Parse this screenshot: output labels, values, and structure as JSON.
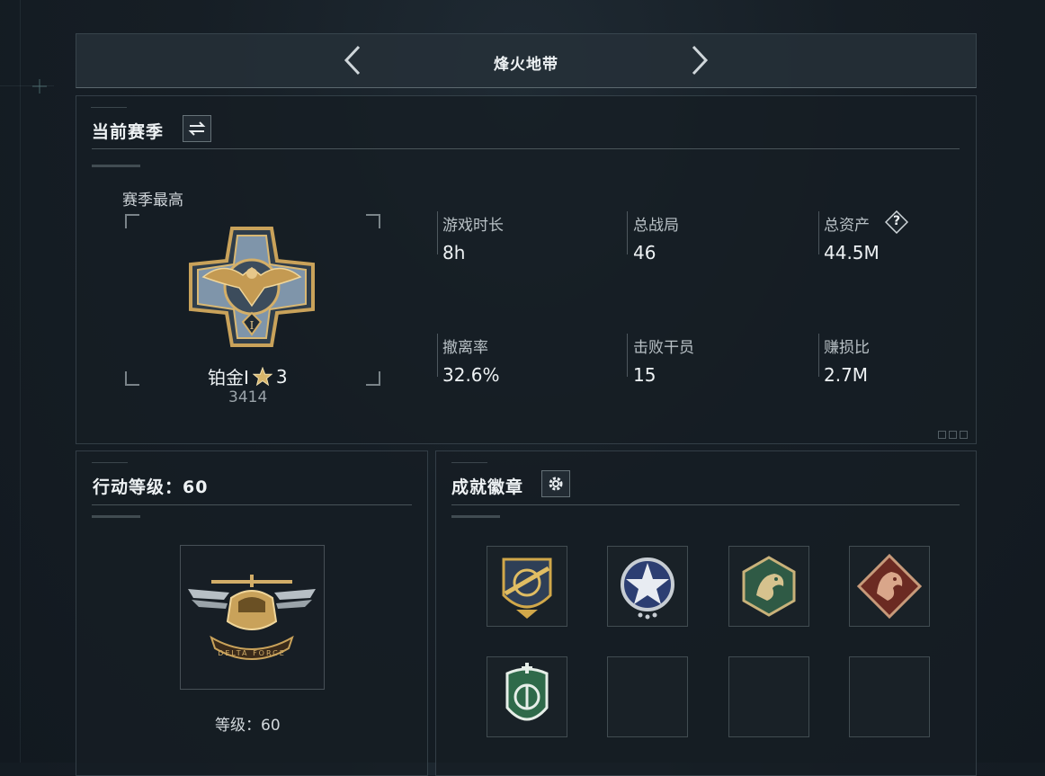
{
  "header": {
    "title": "烽火地带"
  },
  "season": {
    "title": "当前赛季",
    "best_label": "赛季最高",
    "rank_name": "铂金I",
    "rank_stars": "3",
    "rank_score": "3414",
    "stats": [
      {
        "label": "游戏时长",
        "value": "8h"
      },
      {
        "label": "总战局",
        "value": "46"
      },
      {
        "label": "总资产",
        "value": "44.5M"
      },
      {
        "label": "撤离率",
        "value": "32.6%"
      },
      {
        "label": "击败干员",
        "value": "15"
      },
      {
        "label": "赚损比",
        "value": "2.7M"
      }
    ],
    "help_symbol": "?"
  },
  "level": {
    "title": "行动等级：60",
    "caption": "等级：60",
    "emblem_text": "DELTA FORCE"
  },
  "achievements": {
    "title": "成就徽章",
    "badges": [
      {
        "icon": "crosshair-shield-badge",
        "filled": true
      },
      {
        "icon": "star-ring-badge",
        "filled": true
      },
      {
        "icon": "dragon-hexagon-badge",
        "filled": true
      },
      {
        "icon": "dragon-diamond-badge",
        "filled": true
      },
      {
        "icon": "green-shield-badge",
        "filled": true
      },
      {
        "icon": "empty-badge-slot",
        "filled": false
      },
      {
        "icon": "empty-badge-slot",
        "filled": false
      },
      {
        "icon": "empty-badge-slot",
        "filled": false
      }
    ]
  },
  "colors": {
    "accent_gold": "#c9a25a",
    "text": "#eef2f4",
    "muted": "#b8c0c5"
  }
}
